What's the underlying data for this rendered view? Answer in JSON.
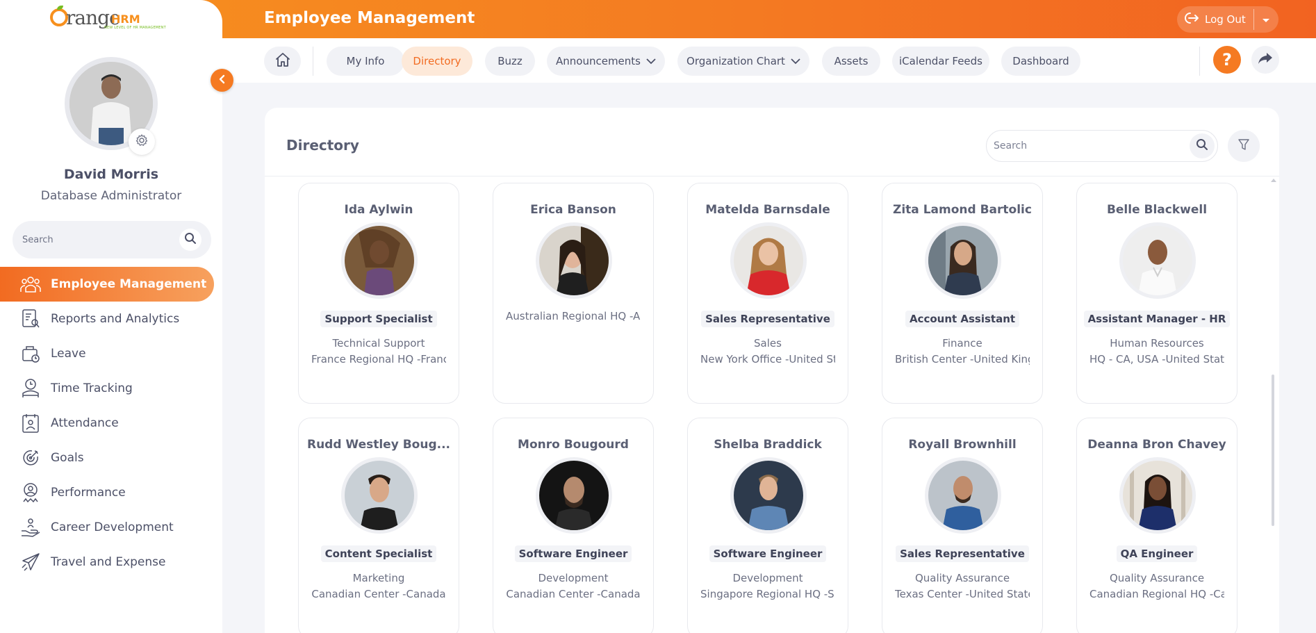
{
  "app": {
    "logo_word": "range",
    "logo_hrm": "HRM",
    "logo_tagline": "NEW LEVEL OF HR MANAGEMENT"
  },
  "header": {
    "title": "Employee Management",
    "logout_label": "Log Out"
  },
  "user": {
    "name": "David Morris",
    "title": "Database Administrator"
  },
  "sidebar": {
    "search_placeholder": "Search",
    "items": [
      {
        "label": "Employee Management",
        "icon": "people-icon",
        "active": true
      },
      {
        "label": "Reports and Analytics",
        "icon": "report-icon",
        "active": false
      },
      {
        "label": "Leave",
        "icon": "leave-icon",
        "active": false
      },
      {
        "label": "Time Tracking",
        "icon": "time-tracking-icon",
        "active": false
      },
      {
        "label": "Attendance",
        "icon": "attendance-icon",
        "active": false
      },
      {
        "label": "Goals",
        "icon": "goals-icon",
        "active": false
      },
      {
        "label": "Performance",
        "icon": "performance-icon",
        "active": false
      },
      {
        "label": "Career Development",
        "icon": "career-icon",
        "active": false
      },
      {
        "label": "Travel and Expense",
        "icon": "plane-icon",
        "active": false
      }
    ]
  },
  "nav": {
    "tabs": [
      {
        "label": "My Info",
        "active": false,
        "dropdown": false
      },
      {
        "label": "Directory",
        "active": true,
        "dropdown": false
      },
      {
        "label": "Buzz",
        "active": false,
        "dropdown": false
      },
      {
        "label": "Announcements",
        "active": false,
        "dropdown": true
      },
      {
        "label": "Organization Chart",
        "active": false,
        "dropdown": true
      },
      {
        "label": "Assets",
        "active": false,
        "dropdown": false
      },
      {
        "label": "iCalendar Feeds",
        "active": false,
        "dropdown": false
      },
      {
        "label": "Dashboard",
        "active": false,
        "dropdown": false
      }
    ],
    "help_label": "?"
  },
  "directory": {
    "title": "Directory",
    "search_placeholder": "Search",
    "employees": [
      {
        "name": "Ida Aylwin",
        "role": "Support Specialist",
        "department": "Technical Support",
        "location": "France Regional HQ -France"
      },
      {
        "name": "Erica Banson",
        "role": "",
        "department": "",
        "location": "Australian Regional HQ -Au"
      },
      {
        "name": "Matelda Barnsdale",
        "role": "Sales Representative",
        "department": "Sales",
        "location": "New York Office -United Sta"
      },
      {
        "name": "Zita Lamond Bartolic",
        "role": "Account Assistant",
        "department": "Finance",
        "location": "British Center -United Kingc"
      },
      {
        "name": "Belle Blackwell",
        "role": "Assistant Manager - HR",
        "department": "Human Resources",
        "location": "HQ - CA, USA -United State"
      },
      {
        "name": "Rudd Westley Boug...",
        "role": "Content Specialist",
        "department": "Marketing",
        "location": "Canadian Center -Canada"
      },
      {
        "name": "Monro Bougourd",
        "role": "Software Engineer",
        "department": "Development",
        "location": "Canadian Center -Canada"
      },
      {
        "name": "Shelba Braddick",
        "role": "Software Engineer",
        "department": "Development",
        "location": "Singapore Regional HQ -Sin"
      },
      {
        "name": "Royall Brownhill",
        "role": "Sales Representative",
        "department": "Quality Assurance",
        "location": "Texas Center -United States"
      },
      {
        "name": "Deanna Bron Chavey",
        "role": "QA Engineer",
        "department": "Quality Assurance",
        "location": "Canadian Regional HQ -Can"
      }
    ]
  },
  "colors": {
    "accent": "#f57a22",
    "accent_light": "#fde9d9",
    "text": "#4c5067"
  }
}
